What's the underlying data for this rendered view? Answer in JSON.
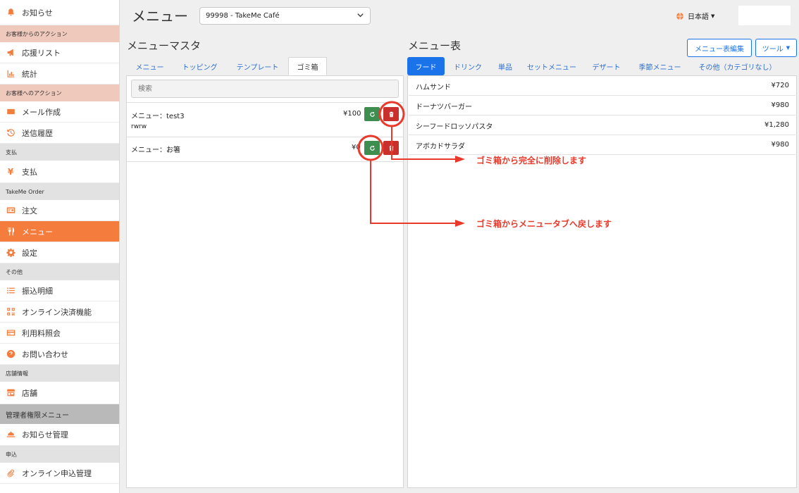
{
  "sidebar": {
    "news": "お知らせ",
    "sec_store_actions": "お客様からのアクション",
    "support_list": "応援リスト",
    "stats": "統計",
    "sec_customer_actions": "お客様へのアクション",
    "mail_compose": "メール作成",
    "send_history": "送信履歴",
    "sec_payment": "支払",
    "payment": "支払",
    "sec_takeme_order": "TakeMe Order",
    "orders": "注文",
    "menu": "メニュー",
    "settings": "設定",
    "sec_other": "その他",
    "transfer_details": "振込明細",
    "online_payment": "オンライン決済機能",
    "fee_inquiry": "利用料照会",
    "contact": "お問い合わせ",
    "sec_store_info": "店舗情報",
    "store": "店舗",
    "sec_admin": "管理者権限メニュー",
    "news_admin": "お知らせ管理",
    "sec_application": "申込",
    "online_application_admin": "オンライン申込管理"
  },
  "header": {
    "title": "メニュー",
    "shop_select_value": "99998 - TakeMe Café",
    "language": "日本語"
  },
  "master": {
    "title": "メニューマスタ",
    "tabs": [
      "メニュー",
      "トッピング",
      "テンプレート",
      "ゴミ箱"
    ],
    "active_tab": "ゴミ箱",
    "search_placeholder": "検索",
    "trash_items": [
      {
        "name": "メニュー：test3",
        "desc": "rwrw",
        "price": "¥100"
      },
      {
        "name": "メニュー：お箸",
        "desc": "",
        "price": "¥0"
      }
    ]
  },
  "menu_table": {
    "title": "メニュー表",
    "edit_button": "メニュー表編集",
    "tools_button": "ツール",
    "tabs": [
      "フード",
      "ドリンク",
      "単品",
      "セットメニュー",
      "デザート",
      "季節メニュー",
      "その他（カテゴリなし）"
    ],
    "active_tab": "フード",
    "items": [
      {
        "name": "ハムサンド",
        "price": "¥720"
      },
      {
        "name": "ドーナツバーガー",
        "price": "¥980"
      },
      {
        "name": "シーフードロッソパスタ",
        "price": "¥1,280"
      },
      {
        "name": "アボカドサラダ",
        "price": "¥980"
      }
    ]
  },
  "annotations": {
    "delete_note": "ゴミ箱から完全に削除します",
    "restore_note": "ゴミ箱からメニュータブへ戻します",
    "color": "#e8392b"
  },
  "colors": {
    "accent_orange": "#f47c3c",
    "primary_blue": "#1a73e8",
    "restore_green": "#3e8e4f",
    "delete_red": "#c9302c"
  }
}
